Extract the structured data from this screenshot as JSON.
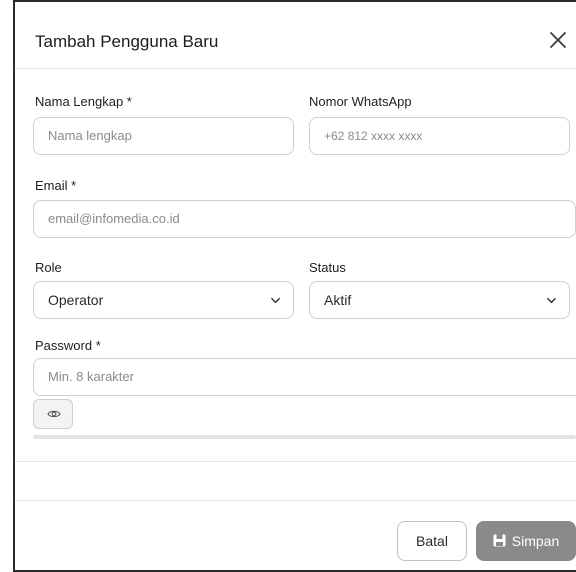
{
  "modal": {
    "title": "Tambah Pengguna Baru"
  },
  "form": {
    "full_name": {
      "label": "Nama Lengkap *",
      "placeholder": "Nama lengkap",
      "value": ""
    },
    "whatsapp": {
      "label": "Nomor WhatsApp",
      "placeholder": "+62 812 xxxx xxxx",
      "value": ""
    },
    "email": {
      "label": "Email *",
      "placeholder": "email@infomedia.co.id",
      "value": ""
    },
    "role": {
      "label": "Role",
      "selected": "Operator"
    },
    "status": {
      "label": "Status",
      "selected": "Aktif"
    },
    "password": {
      "label": "Password *",
      "placeholder": "Min. 8 karakter",
      "value": ""
    }
  },
  "footer": {
    "cancel_label": "Batal",
    "save_label": "Simpan"
  },
  "icons": {
    "close": "close-icon",
    "chevron": "chevron-down-icon",
    "eye": "eye-icon",
    "save": "save-icon"
  },
  "colors": {
    "save_button_bg": "#8a8a8a",
    "border": "#cfcfcf"
  }
}
